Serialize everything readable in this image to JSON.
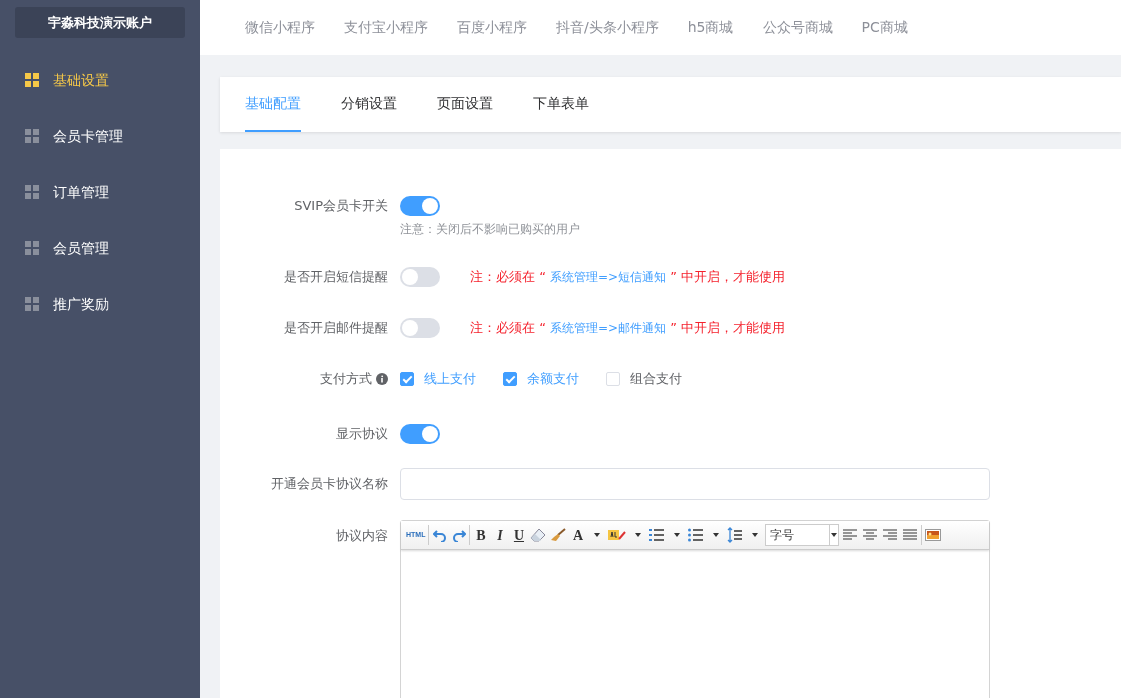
{
  "sidebar": {
    "account": "宇淼科技演示账户",
    "items": [
      {
        "label": "基础设置",
        "selected": true
      },
      {
        "label": "会员卡管理",
        "selected": false
      },
      {
        "label": "订单管理",
        "selected": false
      },
      {
        "label": "会员管理",
        "selected": false
      },
      {
        "label": "推广奖励",
        "selected": false
      }
    ]
  },
  "platform_tabs": [
    "微信小程序",
    "支付宝小程序",
    "百度小程序",
    "抖音/头条小程序",
    "h5商城",
    "公众号商城",
    "PC商城"
  ],
  "sub_tabs": [
    {
      "label": "基础配置",
      "selected": true
    },
    {
      "label": "分销设置",
      "selected": false
    },
    {
      "label": "页面设置",
      "selected": false
    },
    {
      "label": "下单表单",
      "selected": false
    }
  ],
  "form": [
    {
      "kind": "switch",
      "label": "SVIP会员卡开关",
      "on": true,
      "hint": "注意：关闭后不影响已购买的用户"
    },
    {
      "kind": "switch",
      "label": "是否开启短信提醒",
      "on": false,
      "note": {
        "before": "注：必须在 “ ",
        "link": "系统管理=>短信通知",
        "after": " ” 中开启，才能使用"
      }
    },
    {
      "kind": "switch",
      "label": "是否开启邮件提醒",
      "on": false,
      "note": {
        "before": "注：必须在 “ ",
        "link": "系统管理=>邮件通知",
        "after": " ” 中开启，才能使用"
      }
    },
    {
      "kind": "checkboxes",
      "label": "支付方式",
      "info": true,
      "options": [
        {
          "label": "线上支付",
          "checked": true
        },
        {
          "label": "余额支付",
          "checked": true
        },
        {
          "label": "组合支付",
          "checked": false
        }
      ]
    },
    {
      "kind": "switch",
      "label": "显示协议",
      "on": true
    },
    {
      "kind": "input",
      "label": "开通会员卡协议名称"
    },
    {
      "kind": "editor",
      "label": "协议内容",
      "toolbar": {
        "html": "HTML",
        "bold": "B",
        "italic": "I",
        "underline": "U",
        "font_color": "A",
        "font_size": "字号"
      }
    }
  ]
}
